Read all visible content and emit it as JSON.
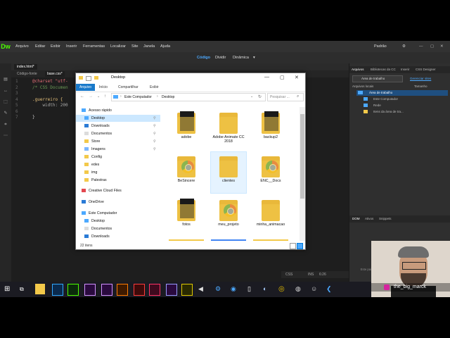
{
  "app": {
    "logo": "Dw",
    "menus": [
      "Arquivo",
      "Editar",
      "Exibir",
      "Inserir",
      "Ferramentas",
      "Localizar",
      "Site",
      "Janela",
      "Ajuda"
    ],
    "workspace": "Padrão",
    "view_modes": [
      "Código",
      "Dividir",
      "Dinâmica"
    ],
    "document_tab": "index.html*",
    "related_files": [
      "Código-fonte",
      "base.css*"
    ],
    "code_lines": [
      {
        "n": "1",
        "text": "@charset \"utf-"
      },
      {
        "n": "2",
        "text": "/* CSS Documen"
      },
      {
        "n": "3",
        "text": ""
      },
      {
        "n": "4",
        "text": ".guerreiro {"
      },
      {
        "n": "5",
        "text": "    width: 200"
      },
      {
        "n": "6",
        "text": ""
      },
      {
        "n": "7",
        "text": "}"
      }
    ],
    "status": {
      "lang": "CSS",
      "mode": "INS",
      "pos": "6:26"
    }
  },
  "right_panel": {
    "tabs": [
      "Arquivos",
      "Bibliotecas da CC",
      "Inserir",
      "CSS Designer"
    ],
    "location_select": "Área de trabalho",
    "manage_sites": "Gerenciar sites",
    "columns": [
      "Arquivos locais",
      "Tamanho"
    ],
    "tree": [
      "Área de trabalho",
      "Este Computador",
      "Rede",
      "Itens da área de tra..."
    ],
    "dom_tabs": [
      "DOM",
      "Ativos",
      "Snippets"
    ],
    "dom_message": "Este painel exibirá a estrutura DOM de documentos HTML."
  },
  "explorer": {
    "title": "Desktop",
    "ribbon_tabs": [
      "Arquivo",
      "Início",
      "Compartilhar",
      "Exibir"
    ],
    "breadcrumb": [
      "Este Computador",
      "Desktop"
    ],
    "search_placeholder": "Pesquisar ...",
    "nav_items": [
      {
        "label": "Acesso rápido",
        "icon": "star-icon",
        "pinned": false,
        "selected": false
      },
      {
        "label": "Desktop",
        "icon": "desktop-icon",
        "pinned": true,
        "selected": true
      },
      {
        "label": "Downloads",
        "icon": "download-icon",
        "pinned": true,
        "selected": false
      },
      {
        "label": "Documentos",
        "icon": "document-icon",
        "pinned": true,
        "selected": false
      },
      {
        "label": "Store",
        "icon": "folder-icon",
        "pinned": true,
        "selected": false
      },
      {
        "label": "Imagens",
        "icon": "picture-icon",
        "pinned": true,
        "selected": false
      },
      {
        "label": "Config",
        "icon": "folder-icon",
        "pinned": false,
        "selected": false
      },
      {
        "label": "edes",
        "icon": "folder-icon",
        "pinned": false,
        "selected": false
      },
      {
        "label": "img",
        "icon": "folder-icon",
        "pinned": false,
        "selected": false
      },
      {
        "label": "Palestras",
        "icon": "folder-icon",
        "pinned": false,
        "selected": false
      },
      {
        "label": "Creative Cloud Files",
        "icon": "cc-icon",
        "pinned": false,
        "selected": false
      },
      {
        "label": "OneDrive",
        "icon": "cloud-icon",
        "pinned": false,
        "selected": false
      },
      {
        "label": "Este Computador",
        "icon": "computer-icon",
        "pinned": false,
        "selected": false
      },
      {
        "label": "Desktop",
        "icon": "desktop-icon",
        "pinned": false,
        "selected": false
      },
      {
        "label": "Documentos",
        "icon": "document-icon",
        "pinned": false,
        "selected": false
      },
      {
        "label": "Downloads",
        "icon": "download-icon",
        "pinned": false,
        "selected": false
      }
    ],
    "items": [
      {
        "label": "adobe",
        "kind": "folder-dark"
      },
      {
        "label": "Adobe Animate CC 2018",
        "kind": "folder"
      },
      {
        "label": "backup2",
        "kind": "folder-dark"
      },
      {
        "label": "BeSincere",
        "kind": "chrome"
      },
      {
        "label": "clientes",
        "kind": "folder-plain",
        "selected": true
      },
      {
        "label": "ENC__Docs",
        "kind": "chrome"
      },
      {
        "label": "fotos",
        "kind": "folder-dark"
      },
      {
        "label": "meu_projeto",
        "kind": "chrome"
      },
      {
        "label": "minha_animacao",
        "kind": "folder"
      }
    ],
    "status": "22 itens"
  },
  "webcam": {
    "handle": "the_big_marck"
  },
  "colors": {
    "dw_green": "#4cff00",
    "accent": "#0078d7",
    "folder": "#f3c94a",
    "selection": "#cce8ff"
  }
}
